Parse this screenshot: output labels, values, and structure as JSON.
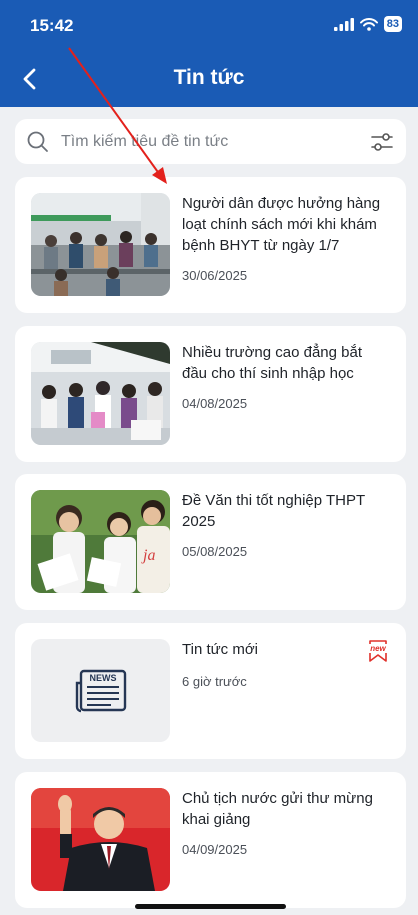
{
  "status_bar": {
    "time": "15:42",
    "battery": "83"
  },
  "header": {
    "title": "Tin tức"
  },
  "search": {
    "placeholder": "Tìm kiếm tiêu đề tin tức"
  },
  "news": [
    {
      "title": "Người dân được hưởng hàng loạt chính sách mới khi khám bệnh BHYT từ ngày 1/7",
      "date": "30/06/2025"
    },
    {
      "title": "Nhiều trường cao đẳng bắt đầu cho thí sinh nhập học",
      "date": "04/08/2025"
    },
    {
      "title": "Đề Văn thi tốt nghiệp THPT 2025",
      "date": "05/08/2025"
    },
    {
      "title": "Tin tức mới",
      "date": "6 giờ trước",
      "badge": "new",
      "thumb_label": "NEWS"
    },
    {
      "title": "Chủ tịch nước gửi thư mừng khai giảng",
      "date": "04/09/2025"
    }
  ],
  "colors": {
    "header": "#1a5bb5",
    "badge": "#e0302a",
    "annotation_arrow": "#e3211c"
  }
}
